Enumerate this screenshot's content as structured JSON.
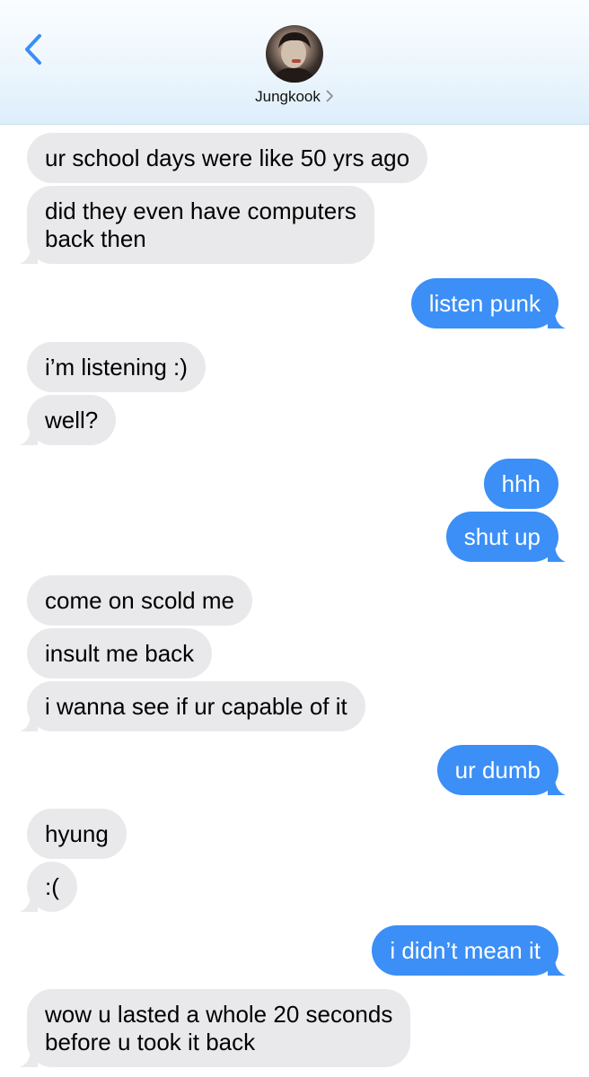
{
  "header": {
    "contact_name": "Jungkook",
    "back_icon": "chevron-left-icon",
    "avatar_icon": "contact-photo"
  },
  "colors": {
    "incoming_bubble": "#e9e9eb",
    "outgoing_bubble": "#3b8ff6",
    "accent": "#3a8ef6"
  },
  "messages": [
    {
      "dir": "in",
      "text": "ur school days were like 50 yrs ago"
    },
    {
      "dir": "in",
      "text": "did they even have computers\nback then"
    },
    {
      "dir": "out",
      "text": "listen punk"
    },
    {
      "dir": "in",
      "text": "i’m listening :)"
    },
    {
      "dir": "in",
      "text": "well?"
    },
    {
      "dir": "out",
      "text": "hhh"
    },
    {
      "dir": "out",
      "text": "shut up"
    },
    {
      "dir": "in",
      "text": "come on scold me"
    },
    {
      "dir": "in",
      "text": "insult me back"
    },
    {
      "dir": "in",
      "text": "i wanna see if ur capable of it"
    },
    {
      "dir": "out",
      "text": "ur dumb"
    },
    {
      "dir": "in",
      "text": "hyung"
    },
    {
      "dir": "in",
      "text": ":("
    },
    {
      "dir": "out",
      "text": "i didn’t mean it"
    },
    {
      "dir": "in",
      "text": "wow u lasted a whole 20 seconds\nbefore u took it back"
    }
  ]
}
